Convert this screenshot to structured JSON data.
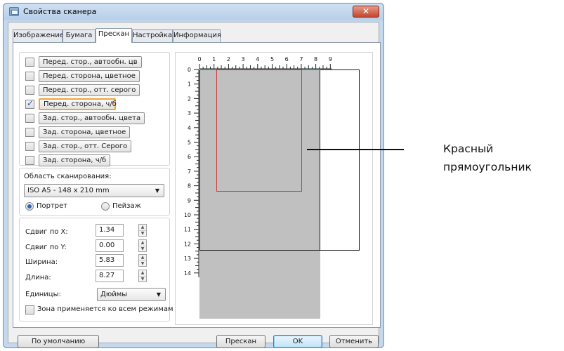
{
  "window": {
    "title": "Свойства сканера",
    "close_glyph": "✕"
  },
  "tabs": [
    "Изображение",
    "Бумага",
    "Прескан",
    "Настройка",
    "Информация"
  ],
  "active_tab": "Прескан",
  "modes": [
    {
      "label": "Перед. стор., автообн. цв",
      "checked": false
    },
    {
      "label": "Перед. сторона, цветное",
      "checked": false
    },
    {
      "label": "Перед. стор., отт. серого",
      "checked": false
    },
    {
      "label": "Перед. сторона, ч/б",
      "checked": true
    },
    {
      "label": "Зад. стор., автообн. цвета",
      "checked": false
    },
    {
      "label": "Зад. сторона, цветное",
      "checked": false
    },
    {
      "label": "Зад. стор., отт. Серого",
      "checked": false
    },
    {
      "label": "Зад. сторона, ч/б",
      "checked": false
    }
  ],
  "scan_area": {
    "label": "Область сканирования:",
    "value": "ISO A5 - 148 x 210 mm",
    "orientation": {
      "portrait": "Портрет",
      "landscape": "Пейзаж",
      "selected": "portrait"
    }
  },
  "fields": {
    "offset_x": {
      "label": "Сдвиг по X:",
      "value": "1.34"
    },
    "offset_y": {
      "label": "Сдвиг по Y:",
      "value": "0.00"
    },
    "width": {
      "label": "Ширина:",
      "value": "5.83"
    },
    "length": {
      "label": "Длина:",
      "value": "8.27"
    },
    "units": {
      "label": "Единицы:",
      "value": "Дюймы"
    },
    "apply_all": {
      "label": "Зона применяется ко всем режимам",
      "checked": false
    }
  },
  "preview": {
    "ruler_h": [
      "0",
      "1",
      "2",
      "3",
      "4",
      "5",
      "6",
      "7",
      "8",
      "9"
    ],
    "ruler_v": [
      "0",
      "1",
      "2",
      "3",
      "4",
      "5",
      "6",
      "7",
      "8",
      "9",
      "10",
      "11",
      "12",
      "13",
      "14"
    ]
  },
  "buttons": {
    "defaults": "По умолчанию",
    "prescan": "Прескан",
    "ok": "OK",
    "cancel": "Отменить"
  },
  "callout": {
    "line1": "Красный",
    "line2": "прямоугольник"
  },
  "colors": {
    "red_rect": "#d13a3a",
    "scan_area": "#c0c0c0",
    "focus": "#f0a43c",
    "close": "#c4452e"
  }
}
